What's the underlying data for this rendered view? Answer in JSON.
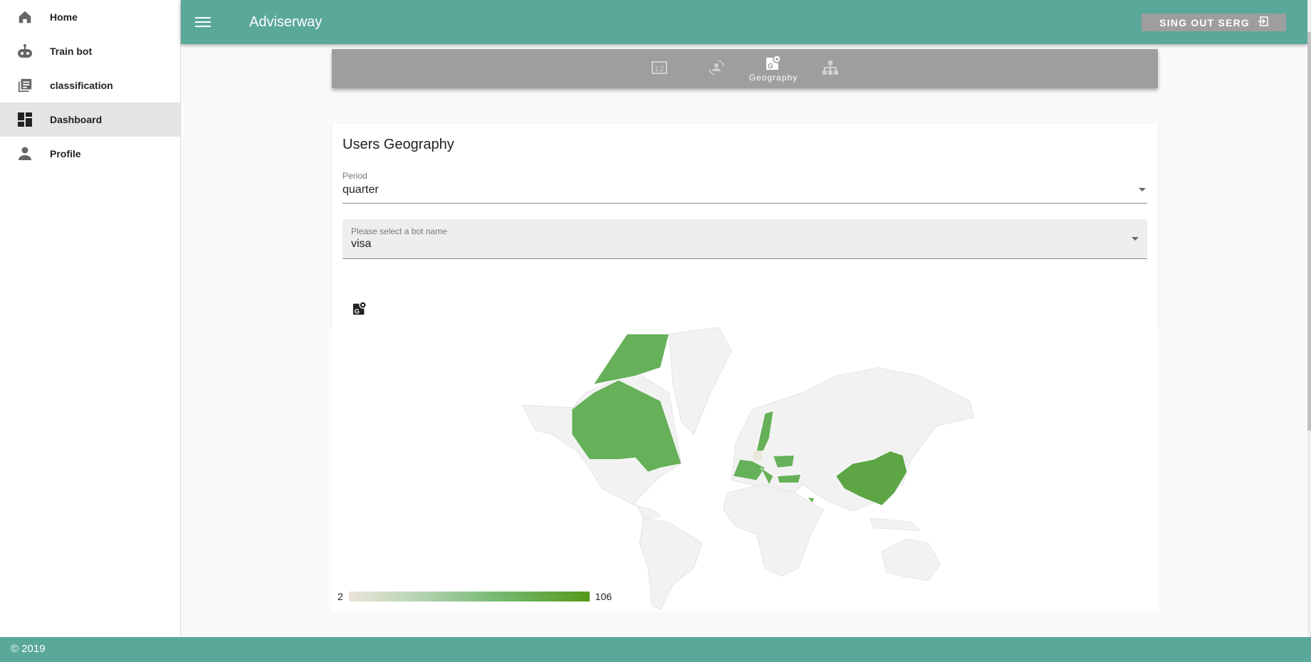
{
  "sidebar": {
    "items": [
      {
        "label": "Home",
        "icon": "home-icon"
      },
      {
        "label": "Train bot",
        "icon": "robot-icon"
      },
      {
        "label": "classification",
        "icon": "library-books-icon"
      },
      {
        "label": "Dashboard",
        "icon": "dashboard-icon",
        "active": true
      },
      {
        "label": "Profile",
        "icon": "person-icon"
      }
    ]
  },
  "header": {
    "title": "Adviserway",
    "signout_label": "SING OUT SERG"
  },
  "tabs": [
    {
      "icon": "numbers-icon",
      "label": ""
    },
    {
      "icon": "user-sync-icon",
      "label": ""
    },
    {
      "icon": "geography-icon",
      "label": "Geography",
      "active": true
    },
    {
      "icon": "sitemap-icon",
      "label": ""
    }
  ],
  "card": {
    "title": "Users Geography",
    "period": {
      "label": "Period",
      "value": "quarter"
    },
    "bot": {
      "label": "Please select a bot name",
      "value": "visa"
    }
  },
  "map": {
    "legend_min": "2",
    "legend_max": "106",
    "colors": {
      "low": "#ebe5da",
      "high": "#549a18",
      "none": "#f2f2f2"
    }
  },
  "footer": {
    "text": "© 2019"
  }
}
